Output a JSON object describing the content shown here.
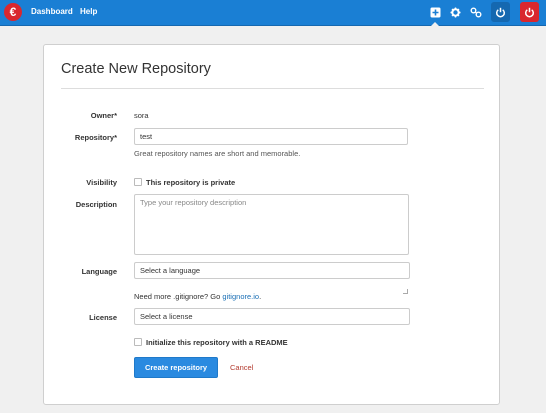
{
  "nav": {
    "logo_glyph": "€",
    "dashboard": "Dashboard",
    "help": "Help",
    "icons": [
      "new-repository-icon",
      "settings-icon",
      "network-icon",
      "power-icon",
      "power-icon"
    ],
    "colors": {
      "bar": "#1a7fd4",
      "logo": "#d9272e",
      "power_blue": "#1568b0",
      "power_red": "#d9272e"
    }
  },
  "form": {
    "title": "Create New Repository",
    "owner": {
      "label": "Owner*",
      "value": "sora"
    },
    "repository": {
      "label": "Repository*",
      "value": "test",
      "help": "Great repository names are short and memorable."
    },
    "visibility": {
      "label": "Visibility",
      "checkbox_label": "This repository is private",
      "checked": false
    },
    "description": {
      "label": "Description",
      "placeholder": "Type your repository description"
    },
    "language": {
      "label": "Language",
      "selected": "Select a language"
    },
    "gitignore": {
      "text": "Need more .gitignore? Go ",
      "link": "gitignore.io",
      "suffix": "."
    },
    "license": {
      "label": "License",
      "selected": "Select a license"
    },
    "readme": {
      "checkbox_label": "Initialize this repository with a README",
      "checked": false
    },
    "submit": "Create repository",
    "cancel": "Cancel"
  }
}
